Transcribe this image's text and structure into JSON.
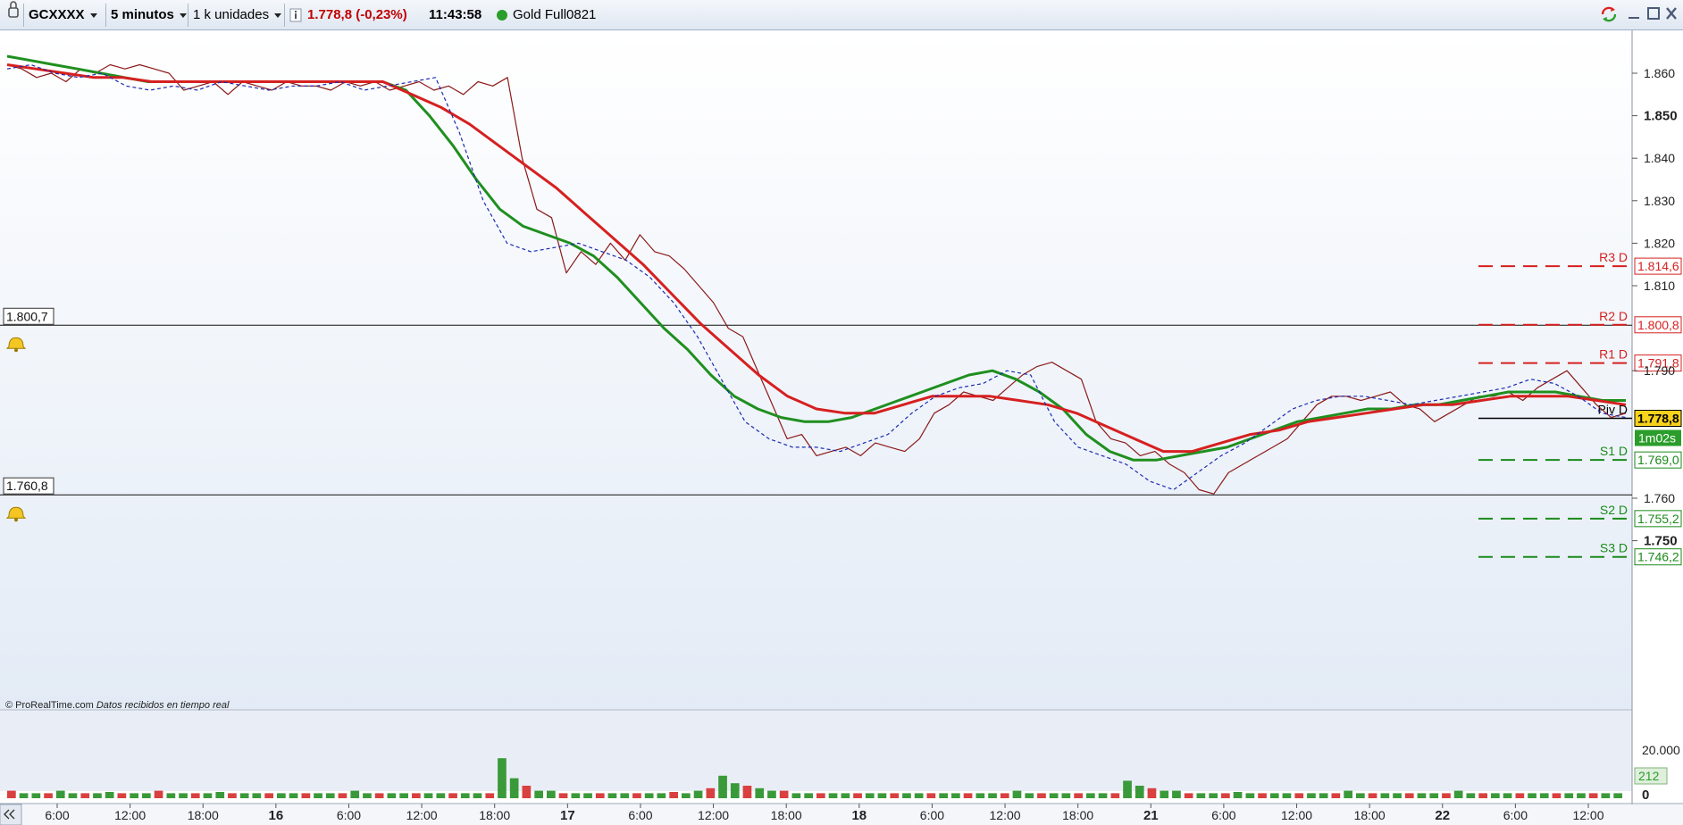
{
  "toolbar": {
    "symbol": "GCXXXX",
    "timeframe": "5 minutos",
    "units": "1 k unidades",
    "info_icon": "info-icon",
    "last_price": "1.778,8",
    "change": "(-0,23%)",
    "time": "11:43:58",
    "instrument": "Gold Full0821",
    "status_color": "#2a9d2a"
  },
  "window_buttons": {
    "refresh": "sync-icon",
    "minimize": "minimize-icon",
    "maximize": "maximize-icon",
    "close": "close-icon"
  },
  "footer": {
    "source": "© ProRealTime.com",
    "realtime": "Datos recibidos en tiempo real"
  },
  "alerts": [
    {
      "label": "1.800,7",
      "price": 1800.7
    },
    {
      "label": "1.760,8",
      "price": 1760.8
    }
  ],
  "levels": [
    {
      "name": "R3 D",
      "value": 1814.6,
      "label": "1.814,6",
      "color": "#d62020"
    },
    {
      "name": "R2 D",
      "value": 1800.8,
      "label": "1.800,8",
      "color": "#d62020"
    },
    {
      "name": "R1 D",
      "value": 1791.8,
      "label": "1.791,8",
      "color": "#d62020"
    },
    {
      "name": "Piv D",
      "value": 1778.8,
      "label": "1.778,8",
      "color": "#000000"
    },
    {
      "name": "S1 D",
      "value": 1769.0,
      "label": "1.769,0",
      "color": "#1a8a1a"
    },
    {
      "name": "S2 D",
      "value": 1755.2,
      "label": "1.755,2",
      "color": "#1a8a1a"
    },
    {
      "name": "S3 D",
      "value": 1746.2,
      "label": "1.746,2",
      "color": "#1a8a1a"
    }
  ],
  "countdown": "1m02s",
  "volume_axis": {
    "ticks": [
      "20.000",
      "0"
    ],
    "current": "212"
  },
  "chart_data": {
    "type": "line",
    "ylim": [
      1750,
      1865
    ],
    "y_ticks": [
      {
        "value": 1860,
        "label": "1.860",
        "bold": false
      },
      {
        "value": 1850,
        "label": "1.850",
        "bold": true
      },
      {
        "value": 1840,
        "label": "1.840",
        "bold": false
      },
      {
        "value": 1830,
        "label": "1.830",
        "bold": false
      },
      {
        "value": 1820,
        "label": "1.820",
        "bold": false
      },
      {
        "value": 1810,
        "label": "1.810",
        "bold": false
      },
      {
        "value": 1790,
        "label": "1.790",
        "bold": false
      },
      {
        "value": 1760,
        "label": "1.760",
        "bold": false
      },
      {
        "value": 1750,
        "label": "1.750",
        "bold": true
      }
    ],
    "x_ticks": [
      "6:00",
      "12:00",
      "18:00",
      "16",
      "6:00",
      "12:00",
      "18:00",
      "17",
      "6:00",
      "12:00",
      "18:00",
      "18",
      "6:00",
      "12:00",
      "18:00",
      "21",
      "6:00",
      "12:00",
      "18:00",
      "22",
      "6:00",
      "12:00"
    ],
    "bold_x_ticks": [
      "16",
      "17",
      "18",
      "21",
      "22"
    ],
    "series": [
      {
        "color": "#8b1a1a",
        "values": [
          1862,
          1861,
          1859,
          1860,
          1858,
          1861,
          1860,
          1862,
          1861,
          1862,
          1861,
          1860,
          1856,
          1857,
          1858,
          1855,
          1858,
          1857,
          1856,
          1858,
          1857,
          1857,
          1856,
          1858,
          1857,
          1858,
          1856,
          1857,
          1858,
          1856,
          1857,
          1855,
          1858,
          1857,
          1859,
          1840,
          1828,
          1826,
          1813,
          1818,
          1815,
          1820,
          1816,
          1822,
          1818,
          1817,
          1814,
          1810,
          1806,
          1800,
          1798,
          1790,
          1782,
          1774,
          1775,
          1770,
          1771,
          1772,
          1770,
          1773,
          1772,
          1771,
          1774,
          1780,
          1782,
          1785,
          1784,
          1783,
          1786,
          1789,
          1791,
          1792,
          1790,
          1788,
          1778,
          1774,
          1773,
          1770,
          1771,
          1768,
          1766,
          1762,
          1761,
          1766,
          1768,
          1770,
          1772,
          1774,
          1778,
          1782,
          1784,
          1784,
          1783,
          1784,
          1785,
          1782,
          1781,
          1778,
          1780,
          1782,
          1784,
          1784,
          1785,
          1783,
          1786,
          1788,
          1790,
          1786,
          1782,
          1779,
          1780
        ]
      },
      {
        "color": "#1f8f1f",
        "values": [
          1864,
          1863,
          1862,
          1861,
          1860,
          1859,
          1858,
          1858,
          1858,
          1858,
          1858,
          1858,
          1858,
          1858,
          1858,
          1858,
          1858,
          1856,
          1850,
          1843,
          1835,
          1828,
          1824,
          1822,
          1820,
          1817,
          1812,
          1806,
          1800,
          1795,
          1789,
          1784,
          1781,
          1779,
          1778,
          1778,
          1779,
          1781,
          1783,
          1785,
          1787,
          1789,
          1790,
          1788,
          1785,
          1781,
          1775,
          1771,
          1769,
          1769,
          1770,
          1771,
          1772,
          1774,
          1776,
          1778,
          1779,
          1780,
          1781,
          1781,
          1782,
          1782,
          1783,
          1784,
          1785,
          1785,
          1785,
          1784,
          1783,
          1783
        ]
      },
      {
        "color": "#d62020",
        "values": [
          1862,
          1861,
          1860,
          1859,
          1859,
          1858,
          1858,
          1858,
          1858,
          1858,
          1858,
          1858,
          1858,
          1858,
          1855,
          1852,
          1848,
          1843,
          1838,
          1833,
          1827,
          1821,
          1815,
          1808,
          1801,
          1795,
          1789,
          1784,
          1781,
          1780,
          1780,
          1782,
          1784,
          1784,
          1784,
          1783,
          1782,
          1780,
          1777,
          1774,
          1771,
          1771,
          1773,
          1775,
          1776,
          1778,
          1779,
          1780,
          1781,
          1782,
          1782,
          1783,
          1784,
          1784,
          1784,
          1783,
          1782
        ]
      },
      {
        "color": "#1b2ab0",
        "dashed": true,
        "values": [
          1861,
          1862,
          1860,
          1859,
          1860,
          1857,
          1856,
          1857,
          1856,
          1858,
          1857,
          1856,
          1857,
          1857,
          1858,
          1856,
          1857,
          1858,
          1859,
          1846,
          1830,
          1820,
          1818,
          1819,
          1820,
          1818,
          1816,
          1812,
          1806,
          1798,
          1788,
          1778,
          1774,
          1772,
          1772,
          1771,
          1773,
          1775,
          1780,
          1784,
          1786,
          1787,
          1790,
          1789,
          1778,
          1772,
          1770,
          1768,
          1764,
          1762,
          1766,
          1770,
          1773,
          1777,
          1781,
          1783,
          1784,
          1784,
          1783,
          1782,
          1783,
          1784,
          1785,
          1786,
          1788,
          1787,
          1784,
          1780,
          1779
        ]
      }
    ],
    "volume": [
      0.3,
      0.2,
      0.2,
      0.2,
      0.3,
      0.2,
      0.2,
      0.2,
      0.25,
      0.2,
      0.2,
      0.2,
      0.3,
      0.2,
      0.2,
      0.2,
      0.2,
      0.25,
      0.2,
      0.2,
      0.2,
      0.2,
      0.2,
      0.2,
      0.2,
      0.2,
      0.2,
      0.2,
      0.3,
      0.2,
      0.2,
      0.2,
      0.2,
      0.2,
      0.2,
      0.2,
      0.2,
      0.2,
      0.2,
      0.2,
      1.6,
      0.8,
      0.5,
      0.3,
      0.3,
      0.2,
      0.2,
      0.2,
      0.2,
      0.2,
      0.2,
      0.2,
      0.2,
      0.2,
      0.25,
      0.2,
      0.3,
      0.4,
      0.9,
      0.6,
      0.5,
      0.4,
      0.3,
      0.3,
      0.2,
      0.2,
      0.2,
      0.2,
      0.2,
      0.2,
      0.2,
      0.2,
      0.2,
      0.2,
      0.2,
      0.2,
      0.2,
      0.2,
      0.2,
      0.2,
      0.2,
      0.2,
      0.3,
      0.2,
      0.2,
      0.2,
      0.2,
      0.2,
      0.2,
      0.2,
      0.2,
      0.7,
      0.5,
      0.4,
      0.3,
      0.3,
      0.2,
      0.2,
      0.2,
      0.2,
      0.25,
      0.2,
      0.2,
      0.2,
      0.2,
      0.2,
      0.2,
      0.2,
      0.2,
      0.3,
      0.2,
      0.2,
      0.2,
      0.2,
      0.2,
      0.2,
      0.2,
      0.2,
      0.3,
      0.2,
      0.2,
      0.2,
      0.2,
      0.2,
      0.2,
      0.2,
      0.2,
      0.2,
      0.2,
      0.2,
      0.2,
      0.2
    ]
  }
}
